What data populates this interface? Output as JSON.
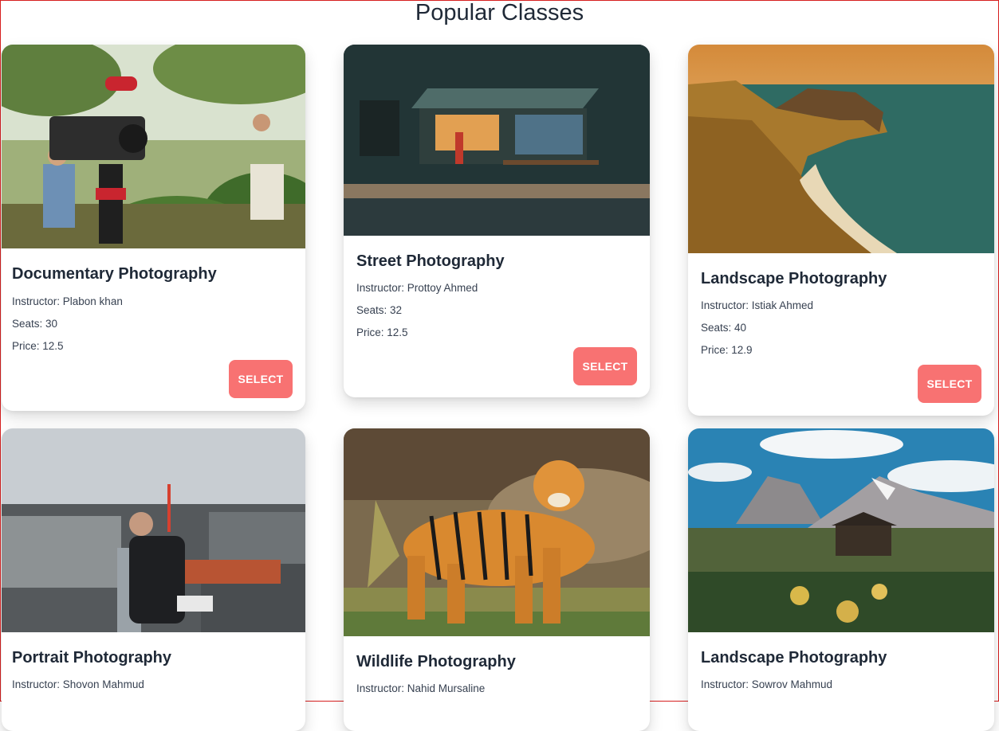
{
  "page_title": "Popular Classes",
  "classes": [
    {
      "name": "Documentary Photography",
      "instructor": "Instructor: Plabon khan",
      "seats": "Seats: 30",
      "price": "Price: 12.5",
      "button": "SELECT"
    },
    {
      "name": "Street Photography",
      "instructor": "Instructor: Prottoy Ahmed",
      "seats": "Seats: 32",
      "price": "Price: 12.5",
      "button": "SELECT"
    },
    {
      "name": "Landscape Photography",
      "instructor": "Instructor: Istiak Ahmed",
      "seats": "Seats: 40",
      "price": "Price: 12.9",
      "button": "SELECT"
    },
    {
      "name": "Portrait Photography",
      "instructor": "Instructor: Shovon Mahmud"
    },
    {
      "name": "Wildlife Photography",
      "instructor": "Instructor: Nahid Mursaline"
    },
    {
      "name": "Landscape Photography",
      "instructor": "Instructor: Sowrov Mahmud"
    }
  ],
  "colors": {
    "accent": "#f87272",
    "heading": "#1f2937",
    "border": "#d61f1f"
  }
}
